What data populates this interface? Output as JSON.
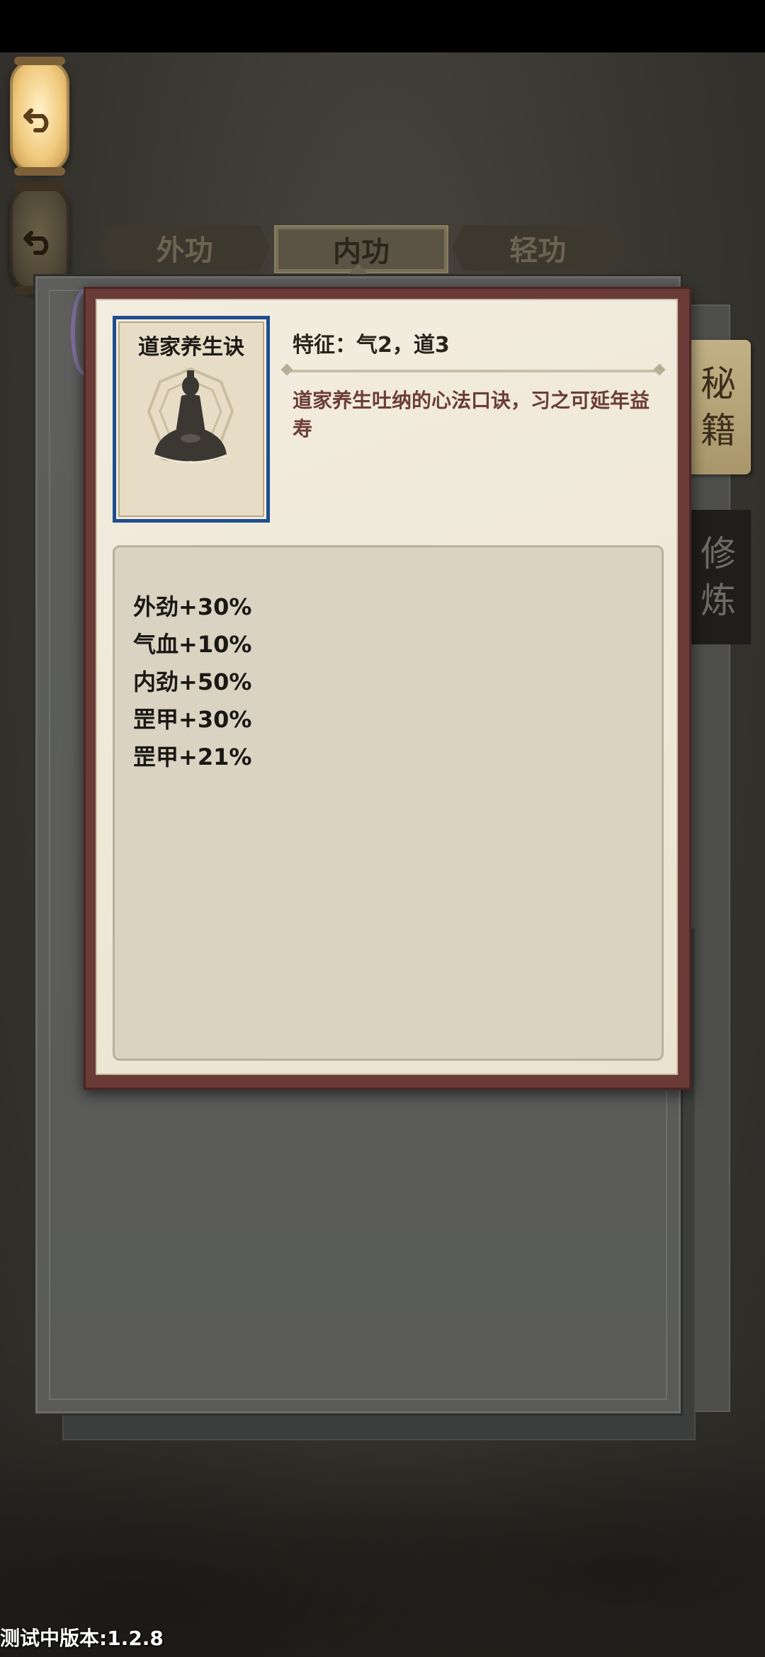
{
  "tabs": [
    {
      "label": "外功",
      "active": false
    },
    {
      "label": "内功",
      "active": true
    },
    {
      "label": "轻功",
      "active": false
    }
  ],
  "side_tabs": {
    "miji": {
      "char1": "秘",
      "char2": "籍"
    },
    "xiulian": {
      "char1": "修",
      "char2": "炼"
    }
  },
  "skill": {
    "name": "道家养生诀",
    "feature": "特征：气2，道3",
    "description": "道家养生吐纳的心法口诀，习之可延年益寿",
    "stats": [
      "外劲+30%",
      "气血+10%",
      "内劲+50%",
      "罡甲+30%",
      "罡甲+21%"
    ]
  },
  "version": "测试中版本:1.2.8",
  "colors": {
    "portrait_border": "#1f4d8f",
    "modal_frame": "#6b3b37",
    "description_text": "#6b3e36"
  },
  "icons": {
    "back_button_top": "undo-arrow-icon",
    "back_button_bottom": "undo-arrow-icon",
    "portrait": "meditating-figure-icon"
  }
}
